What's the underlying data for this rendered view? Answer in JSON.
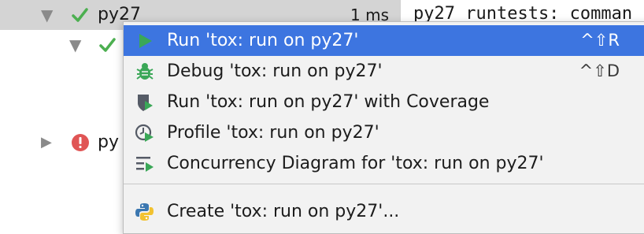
{
  "tree": {
    "rows": [
      {
        "name": "py27",
        "time": "1 ms",
        "status": "passed",
        "expanded": true
      },
      {
        "name": "",
        "status": "passed",
        "expanded": true
      },
      {
        "name": "py",
        "status": "error",
        "expanded": false
      }
    ]
  },
  "console": {
    "lines": [
      "py27 runtests: comman"
    ]
  },
  "menu": {
    "items": [
      {
        "label": "Run 'tox: run on py27'",
        "shortcut": "^⇧R",
        "icon": "run-icon",
        "highlighted": true
      },
      {
        "label": "Debug 'tox: run on py27'",
        "shortcut": "^⇧D",
        "icon": "debug-icon"
      },
      {
        "label": "Run 'tox: run on py27' with Coverage",
        "shortcut": "",
        "icon": "coverage-icon"
      },
      {
        "label": "Profile 'tox: run on py27'",
        "shortcut": "",
        "icon": "profile-icon"
      },
      {
        "label": "Concurrency Diagram for 'tox: run on py27'",
        "shortcut": "",
        "icon": "concurrency-icon"
      },
      {
        "label": "Create 'tox: run on py27'...",
        "shortcut": "",
        "icon": "python-icon"
      }
    ]
  },
  "colors": {
    "highlight": "#3d75e0",
    "run_green": "#3aa757",
    "check_green": "#4caf50",
    "error_red": "#e05555"
  }
}
